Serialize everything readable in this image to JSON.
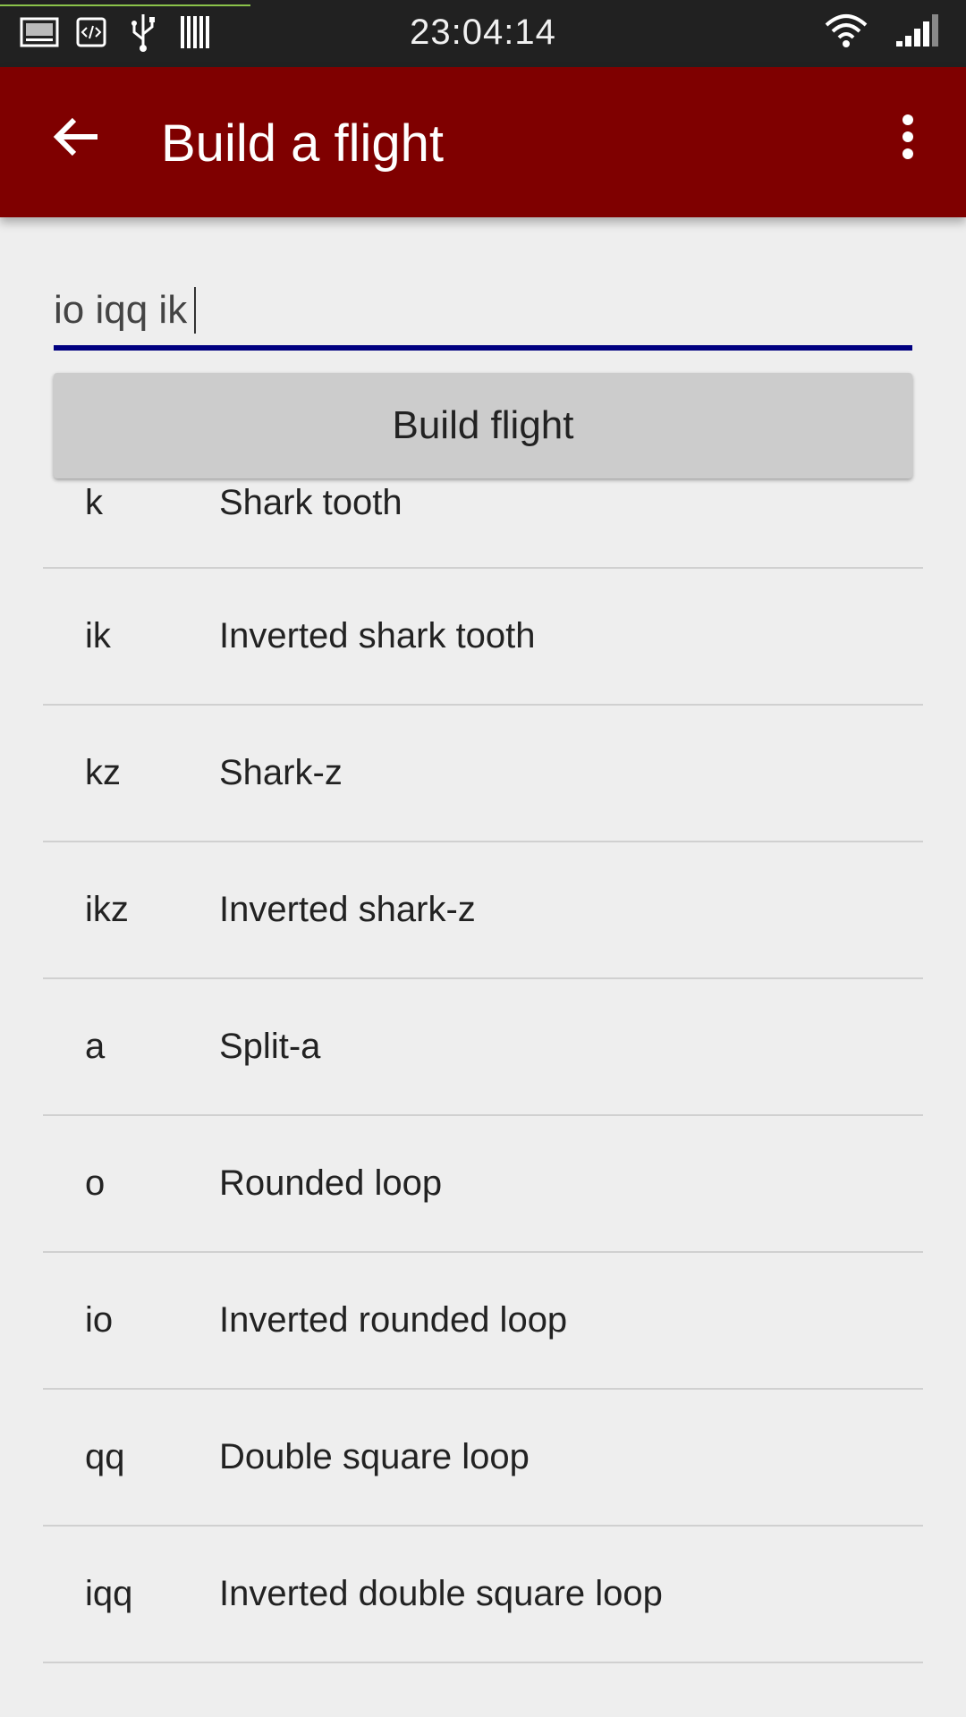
{
  "status_bar": {
    "time": "23:04:14",
    "left_icons": [
      "image-icon",
      "code-icon",
      "usb-icon",
      "barcode-icon"
    ],
    "right_icons": [
      "wifi-icon",
      "signal-icon"
    ]
  },
  "app_bar": {
    "title": "Build a flight",
    "background": "#7f0000",
    "back_icon": "arrow-back-icon",
    "menu_icon": "more-vert-icon"
  },
  "input": {
    "value": "io iqq ik",
    "underline_color": "#000080"
  },
  "build_button": {
    "label": "Build flight"
  },
  "maneuvers": [
    {
      "code": "k",
      "name": "Shark tooth"
    },
    {
      "code": "ik",
      "name": "Inverted shark tooth"
    },
    {
      "code": "kz",
      "name": "Shark-z"
    },
    {
      "code": "ikz",
      "name": "Inverted shark-z"
    },
    {
      "code": "a",
      "name": "Split-a"
    },
    {
      "code": "o",
      "name": "Rounded loop"
    },
    {
      "code": "io",
      "name": "Inverted rounded loop"
    },
    {
      "code": "qq",
      "name": "Double square loop"
    },
    {
      "code": "iqq",
      "name": "Inverted double square loop"
    }
  ]
}
